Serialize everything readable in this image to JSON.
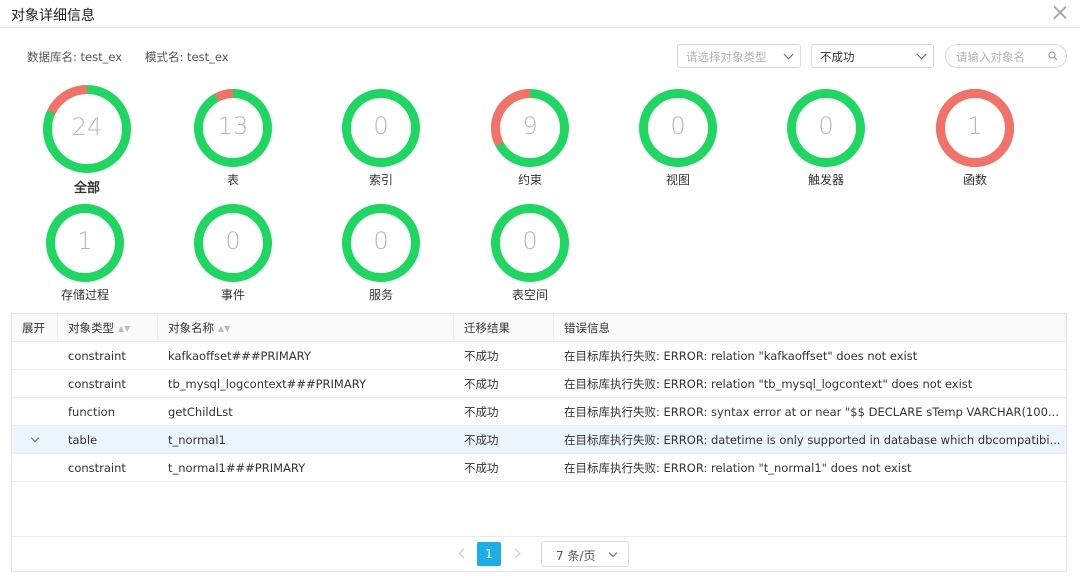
{
  "dialog": {
    "title": "对象详细信息"
  },
  "info": {
    "db_label": "数据库名:",
    "db_value": "test_ex",
    "schema_label": "模式名:",
    "schema_value": "test_ex"
  },
  "filters": {
    "type_placeholder": "请选择对象类型",
    "status_value": "不成功",
    "search_placeholder": "请输入对象名"
  },
  "colors": {
    "success": "#1ed760",
    "fail": "#f47168",
    "accent": "#1daee6"
  },
  "gauges": [
    {
      "label": "全部",
      "total": "24",
      "fail_fraction": 0.18
    },
    {
      "label": "表",
      "total": "13",
      "fail_fraction": 0.08
    },
    {
      "label": "索引",
      "total": "0",
      "fail_fraction": 0
    },
    {
      "label": "约束",
      "total": "9",
      "fail_fraction": 0.33
    },
    {
      "label": "视图",
      "total": "0",
      "fail_fraction": 0
    },
    {
      "label": "触发器",
      "total": "0",
      "fail_fraction": 0
    },
    {
      "label": "函数",
      "total": "1",
      "fail_fraction": 1
    },
    {
      "label": "存储过程",
      "total": "1",
      "fail_fraction": 0
    },
    {
      "label": "事件",
      "total": "0",
      "fail_fraction": 0
    },
    {
      "label": "服务",
      "total": "0",
      "fail_fraction": 0
    },
    {
      "label": "表空间",
      "total": "0",
      "fail_fraction": 0
    }
  ],
  "table": {
    "headers": {
      "expand": "展开",
      "type": "对象类型",
      "name": "对象名称",
      "result": "迁移结果",
      "error": "错误信息"
    },
    "rows": [
      {
        "type": "constraint",
        "name": "kafkaoffset###PRIMARY",
        "result": "不成功",
        "error": "在目标库执行失败: ERROR: relation \"kafkaoffset\" does not exist"
      },
      {
        "type": "constraint",
        "name": "tb_mysql_logcontext###PRIMARY",
        "result": "不成功",
        "error": "在目标库执行失败: ERROR: relation \"tb_mysql_logcontext\" does not exist"
      },
      {
        "type": "function",
        "name": "getChildLst",
        "result": "不成功",
        "error": "在目标库执行失败: ERROR: syntax error at or near \"$$ DECLARE sTemp VARCHAR(100..."
      },
      {
        "type": "table",
        "name": "t_normal1",
        "result": "不成功",
        "error": "在目标库执行失败: ERROR: datetime is only supported in database which dbcompatibi..."
      },
      {
        "type": "constraint",
        "name": "t_normal1###PRIMARY",
        "result": "不成功",
        "error": "在目标库执行失败: ERROR: relation \"t_normal1\" does not exist"
      }
    ]
  },
  "pager": {
    "current_page": "1",
    "page_size": "7 条/页"
  }
}
